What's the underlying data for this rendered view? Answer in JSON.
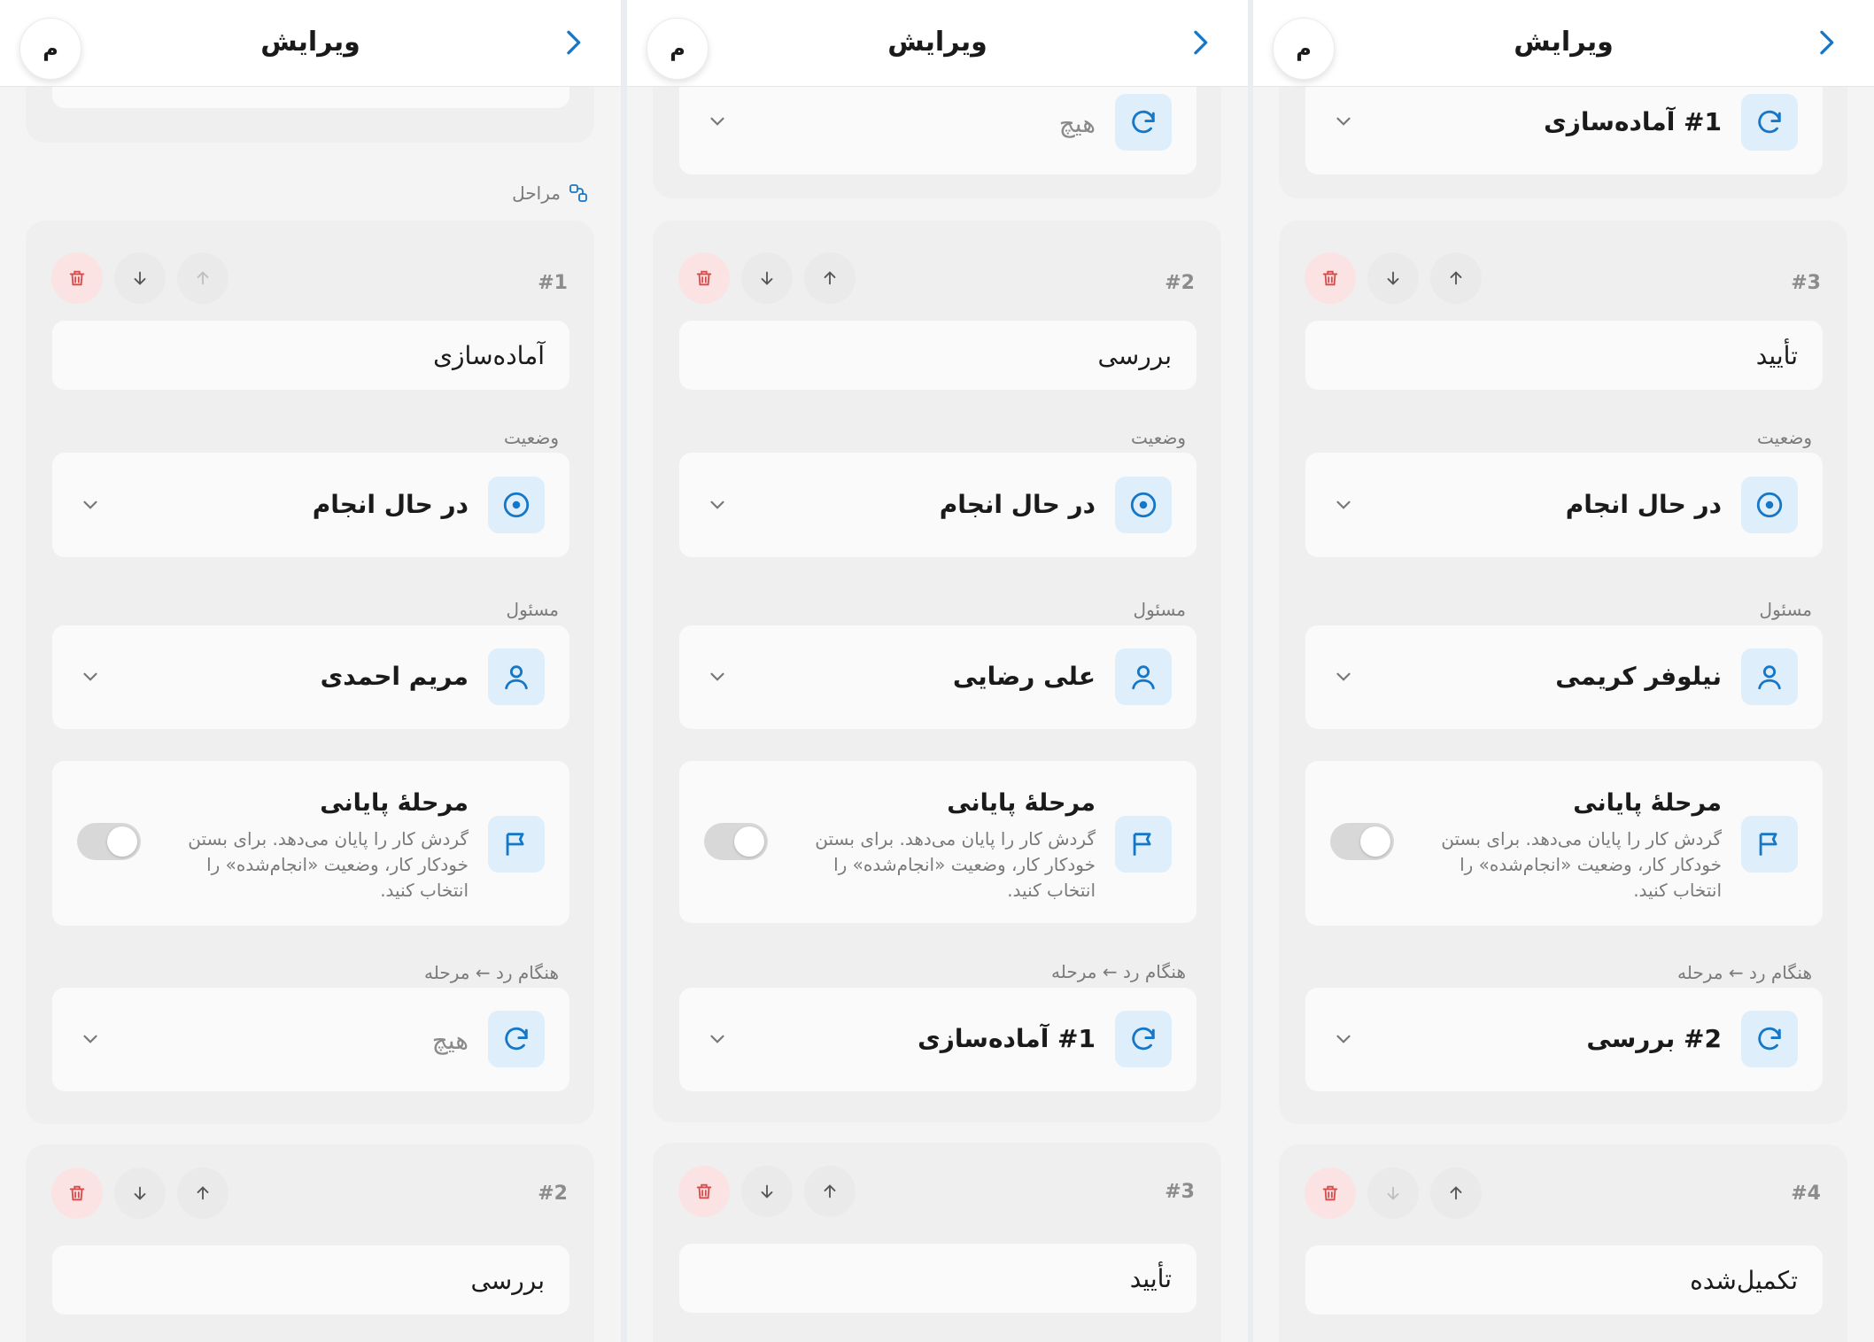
{
  "colors": {
    "accent": "#1677c7",
    "accent_bg": "#deeefb",
    "danger": "#d94a4a",
    "danger_bg": "#fbe3e3"
  },
  "labels": {
    "status": "وضعیت",
    "assignee": "مسئول",
    "on_reject": "هنگام رد ← مرحله",
    "terminal_title": "مرحلهٔ پایانی",
    "terminal_desc": "گردش کار را پایان می‌دهد. برای بستن خودکار کار، وضعیت «انجام‌شده» را انتخاب کنید."
  },
  "screens": [
    {
      "header": {
        "title": "ویرایش",
        "avatar": "م"
      },
      "steps_header": "مراحل",
      "step": {
        "number": "#1",
        "name": "آماده‌سازی",
        "status": "در حال انجام",
        "assignee": "مریم احمدی",
        "reject_target": "هیچ"
      },
      "next": {
        "number": "#2",
        "name": "بررسی"
      }
    },
    {
      "header": {
        "title": "ویرایش",
        "avatar": "م"
      },
      "prev": {
        "reject_target": "هیچ"
      },
      "step": {
        "number": "#2",
        "name": "بررسی",
        "status": "در حال انجام",
        "assignee": "علی رضایی",
        "reject_target": "#1 آماده‌سازی"
      },
      "next": {
        "number": "#3",
        "name": "تأیید"
      }
    },
    {
      "header": {
        "title": "ویرایش",
        "avatar": "م"
      },
      "prev": {
        "reject_target": "#1 آماده‌سازی"
      },
      "step": {
        "number": "#3",
        "name": "تأیید",
        "status": "در حال انجام",
        "assignee": "نیلوفر کریمی",
        "reject_target": "#2 بررسی"
      },
      "next": {
        "number": "#4",
        "name": "تکمیل‌شده"
      }
    }
  ],
  "icons": [
    "chevron-right-icon",
    "trash-icon",
    "arrow-down-icon",
    "arrow-up-icon",
    "status-circle-icon",
    "user-icon",
    "flag-icon",
    "redo-arrow-icon",
    "chevron-down-icon",
    "steps-icon"
  ]
}
